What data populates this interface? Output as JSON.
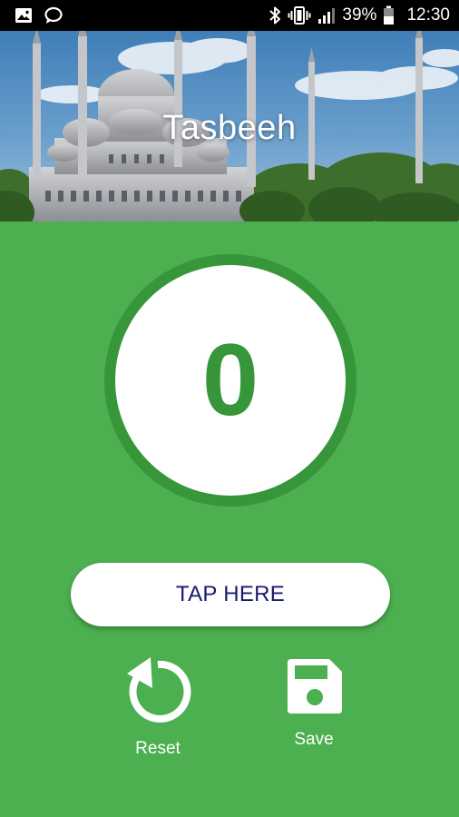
{
  "status_bar": {
    "battery_percent": "39%",
    "time": "12:30",
    "icons": [
      "image-icon",
      "chat-bubble-icon",
      "bluetooth-icon",
      "vibrate-icon",
      "signal-icon",
      "battery-icon"
    ]
  },
  "header": {
    "title": "Tasbeeh",
    "background": "mosque-photo"
  },
  "counter": {
    "value": "0"
  },
  "tap_button": {
    "label": "TAP HERE"
  },
  "actions": {
    "reset_label": "Reset",
    "save_label": "Save"
  },
  "colors": {
    "background": "#4caf50",
    "ring": "#37963a",
    "counter_text": "#37963a",
    "tap_text": "#1a1a6e"
  }
}
